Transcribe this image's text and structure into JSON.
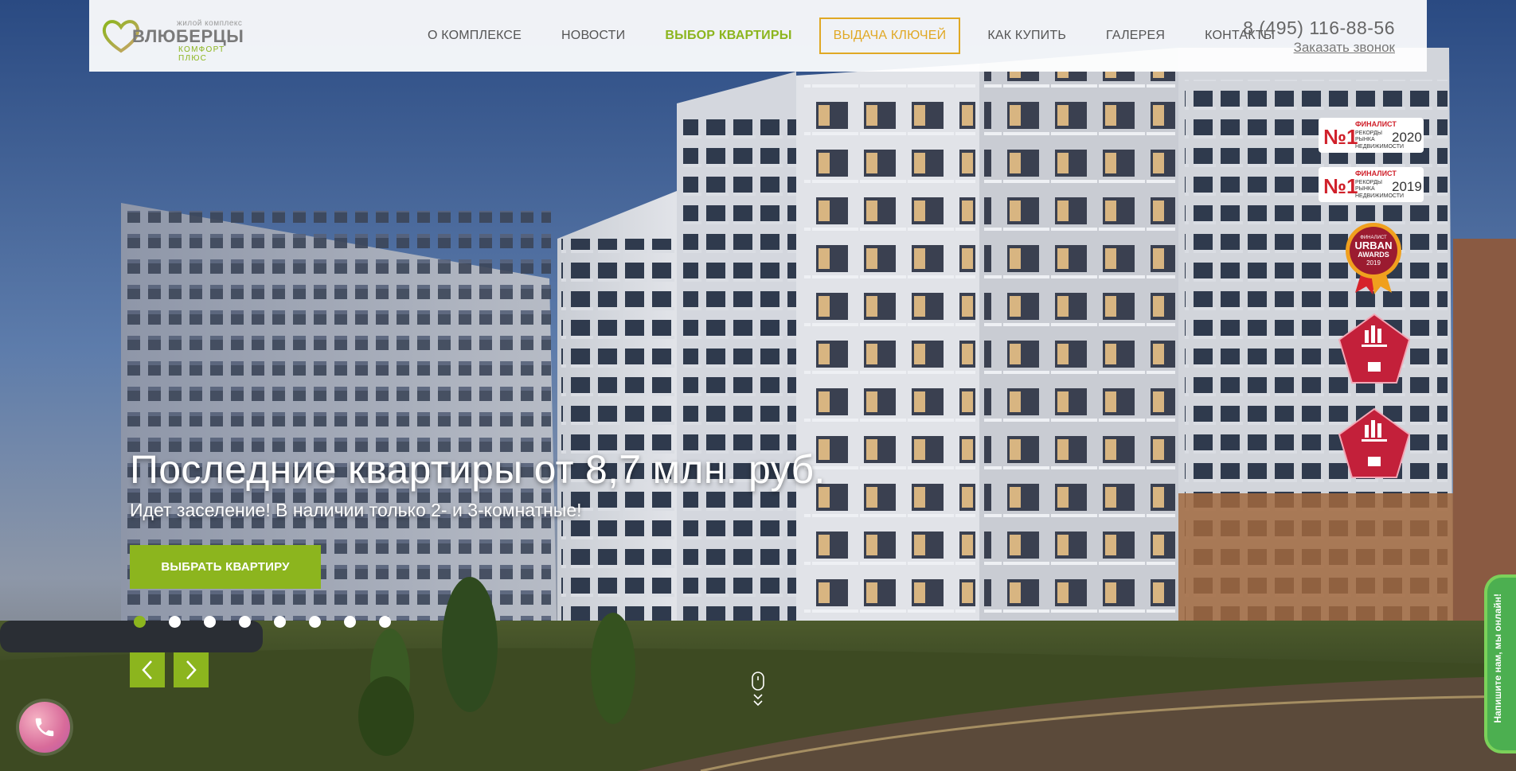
{
  "logo": {
    "small": "жилой комплекс",
    "big": "ВЛЮБЕРЦЫ",
    "sub": "КОМФОРТ ПЛЮС"
  },
  "nav": {
    "items": [
      {
        "label": "О КОМПЛЕКСЕ"
      },
      {
        "label": "НОВОСТИ"
      },
      {
        "label": "ВЫБОР КВАРТИРЫ"
      },
      {
        "label": "ВЫДАЧА КЛЮЧЕЙ"
      },
      {
        "label": "КАК КУПИТЬ"
      },
      {
        "label": "ГАЛЕРЕЯ"
      },
      {
        "label": "КОНТАКТЫ"
      }
    ]
  },
  "contact": {
    "phone": "8 (495) 116-88-56",
    "callback": "Заказать звонок"
  },
  "hero": {
    "title": "Последние квартиры от 8,7 млн. руб.",
    "subtitle": "Идет заселение! В наличии только 2- и 3-комнатные!",
    "cta": "ВЫБРАТЬ КВАРТИРУ",
    "slides_count": 8,
    "active_slide": 1
  },
  "badges": {
    "record2020": {
      "text1": "ФИНАЛИСТ",
      "text2": "РЕКОРДЫ",
      "text3": "РЫНКА",
      "text4": "НЕДВИЖИМОСТИ",
      "year": "2020"
    },
    "record2019": {
      "text1": "ФИНАЛИСТ",
      "text2": "РЕКОРДЫ",
      "text3": "РЫНКА",
      "text4": "НЕДВИЖИМОСТИ",
      "year": "2019"
    },
    "urban": {
      "line1": "ФИНАЛИСТ",
      "line2": "URBAN",
      "line3": "AWARDS",
      "line4": "2019"
    }
  },
  "chat": {
    "label": "Напишите нам, мы онлайн!"
  },
  "colors": {
    "accent": "#8cb51e",
    "highlight": "#e0a824"
  },
  "icons": [
    "heart-logo-icon",
    "arrow-left-icon",
    "arrow-right-icon",
    "mouse-scroll-icon",
    "phone-icon",
    "award-record-icon",
    "urban-awards-icon",
    "national-prize-icon"
  ]
}
